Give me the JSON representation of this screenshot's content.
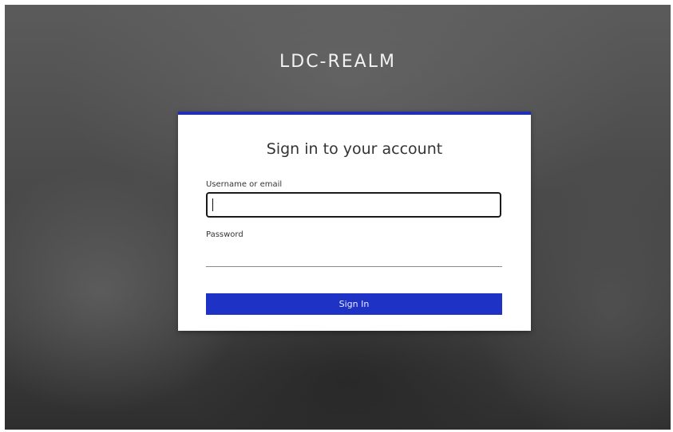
{
  "realm": {
    "title": "LDC-REALM"
  },
  "login": {
    "heading": "Sign in to your account",
    "username": {
      "label": "Username or email",
      "value": "",
      "placeholder": ""
    },
    "password": {
      "label": "Password",
      "value": "",
      "placeholder": ""
    },
    "submit_label": "Sign In"
  },
  "colors": {
    "accent": "#1e33c6",
    "card_border": "#1f2fb8",
    "background": "#4a4a4a",
    "card": "#ffffff"
  }
}
